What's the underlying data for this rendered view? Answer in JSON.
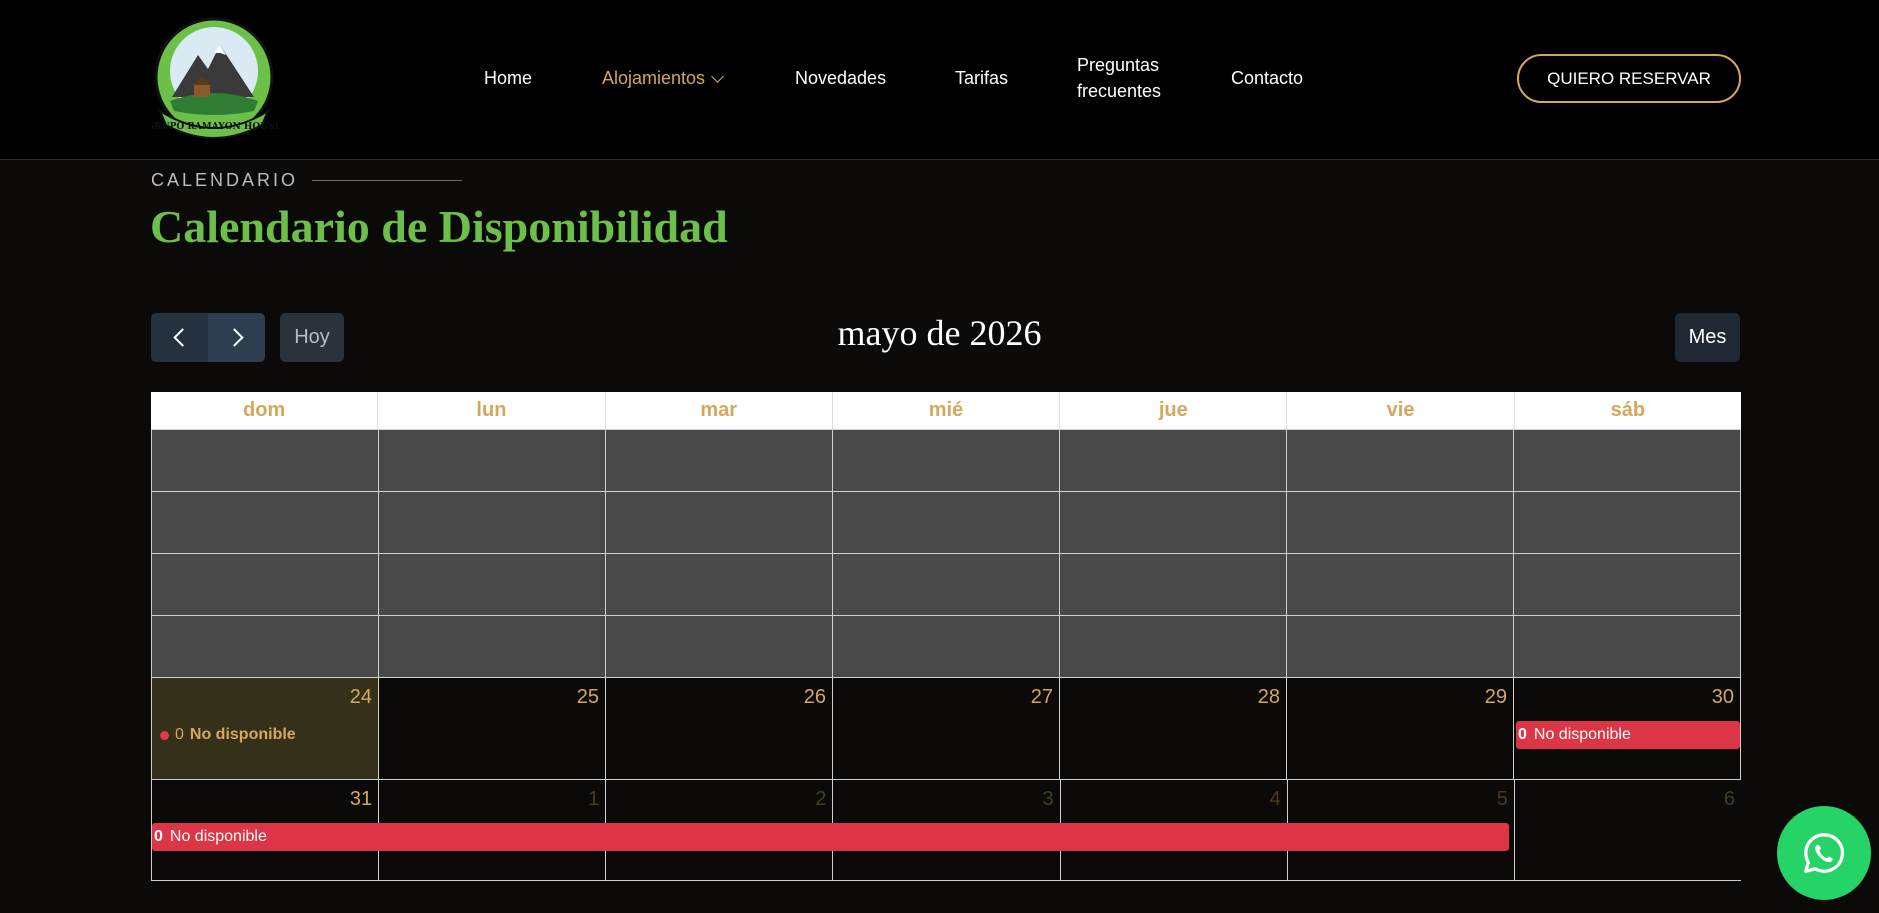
{
  "brand": {
    "logo_text": "GRUPO RAMAYON HOUSE"
  },
  "nav": {
    "home": "Home",
    "alojamientos": "Alojamientos",
    "novedades": "Novedades",
    "tarifas": "Tarifas",
    "preguntas_line1": "Preguntas",
    "preguntas_line2": "frecuentes",
    "contacto": "Contacto",
    "reserve": "QUIERO RESERVAR"
  },
  "section": {
    "eyebrow": "CALENDARIO",
    "title": "Calendario de Disponibilidad"
  },
  "toolbar": {
    "today": "Hoy",
    "month_title": "mayo de 2026",
    "view": "Mes"
  },
  "calendar": {
    "weekdays": [
      "dom",
      "lun",
      "mar",
      "mié",
      "jue",
      "vie",
      "sáb"
    ],
    "week5": [
      "24",
      "25",
      "26",
      "27",
      "28",
      "29",
      "30"
    ],
    "week6": [
      "31",
      "1",
      "2",
      "3",
      "4",
      "5",
      "6"
    ],
    "event_count": "0",
    "event_label": "No disponible"
  },
  "colors": {
    "accent": "#d4a85c",
    "title_green": "#6cc04a",
    "unavailable": "#dc3545",
    "whatsapp": "#25d366"
  }
}
